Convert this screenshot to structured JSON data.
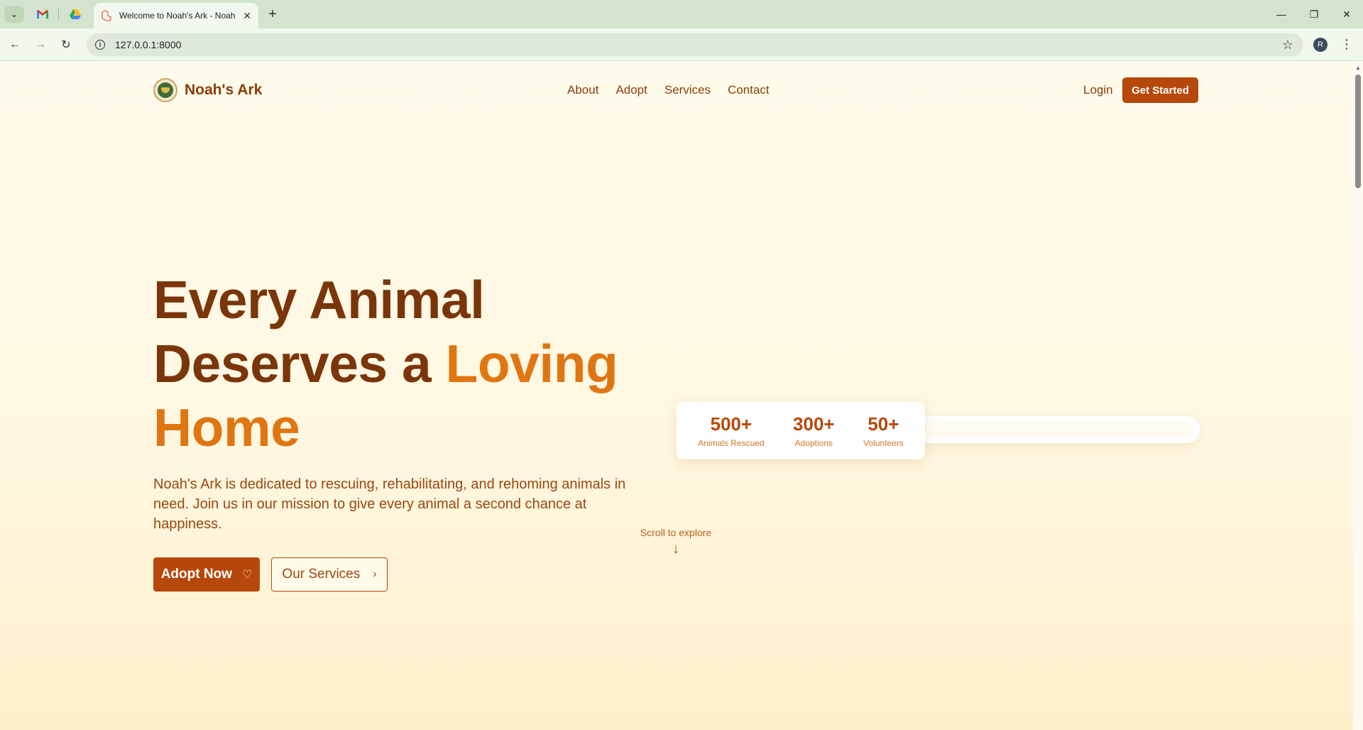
{
  "browser": {
    "tab_title": "Welcome to Noah's Ark - Noah",
    "url": "127.0.0.1:8000",
    "profile_initial": "R"
  },
  "site": {
    "brand": "Noah's Ark",
    "nav": [
      "About",
      "Adopt",
      "Services",
      "Contact"
    ],
    "login": "Login",
    "cta": "Get Started"
  },
  "hero": {
    "title_line1": "Every Animal",
    "title_line2_plain": "Deserves a ",
    "title_line2_accent": "Loving",
    "title_line3_accent": "Home",
    "description": "Noah's Ark is dedicated to rescuing, rehabilitating, and rehoming animals in need. Join us in our mission to give every animal a second chance at happiness.",
    "primary_button": "Adopt Now",
    "secondary_button": "Our Services"
  },
  "stats": [
    {
      "value": "500+",
      "label": "Animals Rescued"
    },
    {
      "value": "300+",
      "label": "Adoptions"
    },
    {
      "value": "50+",
      "label": "Volunteers"
    }
  ],
  "scroll_hint": "Scroll to explore",
  "colors": {
    "primary": "#b6480b",
    "title": "#7a3509",
    "accent": "#e07612"
  }
}
